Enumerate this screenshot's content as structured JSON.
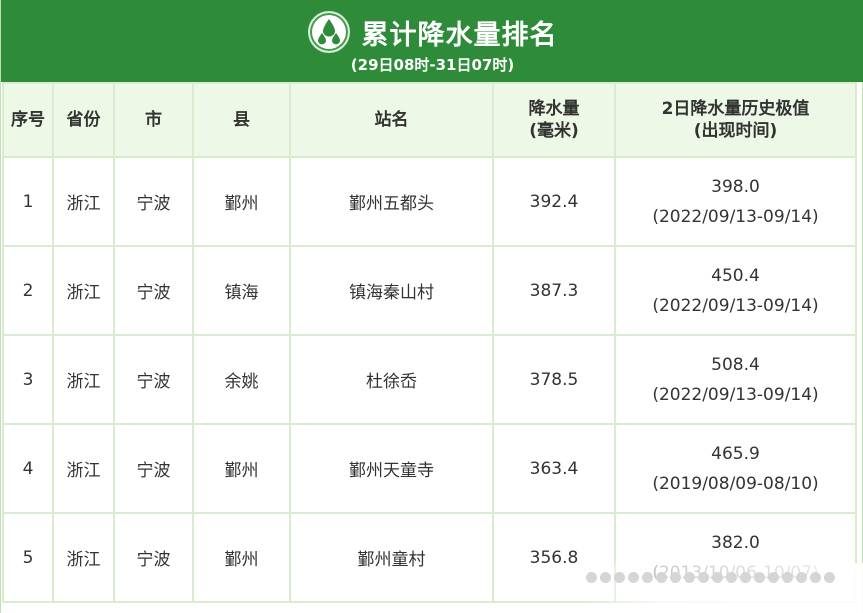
{
  "header": {
    "title": "累计降水量排名",
    "subtitle": "(29日08时-31日07时)",
    "icon": "raindrops-icon",
    "color_banner": "#2e8b3a",
    "color_header_bg": "#eef8e6"
  },
  "table": {
    "columns": {
      "rank": "序号",
      "province": "省份",
      "city": "市",
      "county": "县",
      "station": "站名",
      "precip_line1": "降水量",
      "precip_line2": "(毫米)",
      "history_line1": "2日降水量历史极值",
      "history_line2": "(出现时间)"
    },
    "rows": [
      {
        "rank": "1",
        "province": "浙江",
        "city": "宁波",
        "county": "鄞州",
        "station": "鄞州五都头",
        "precip": "392.4",
        "history_value": "398.0",
        "history_date": "(2022/09/13-09/14)"
      },
      {
        "rank": "2",
        "province": "浙江",
        "city": "宁波",
        "county": "镇海",
        "station": "镇海秦山村",
        "precip": "387.3",
        "history_value": "450.4",
        "history_date": "(2022/09/13-09/14)"
      },
      {
        "rank": "3",
        "province": "浙江",
        "city": "宁波",
        "county": "余姚",
        "station": "杜徐岙",
        "precip": "378.5",
        "history_value": "508.4",
        "history_date": "(2022/09/13-09/14)"
      },
      {
        "rank": "4",
        "province": "浙江",
        "city": "宁波",
        "county": "鄞州",
        "station": "鄞州天童寺",
        "precip": "363.4",
        "history_value": "465.9",
        "history_date": "(2019/08/09-08/10)"
      },
      {
        "rank": "5",
        "province": "浙江",
        "city": "宁波",
        "county": "鄞州",
        "station": "鄞州童村",
        "precip": "356.8",
        "history_value": "382.0",
        "history_date": "(2013/10/06-10/07)"
      }
    ]
  }
}
